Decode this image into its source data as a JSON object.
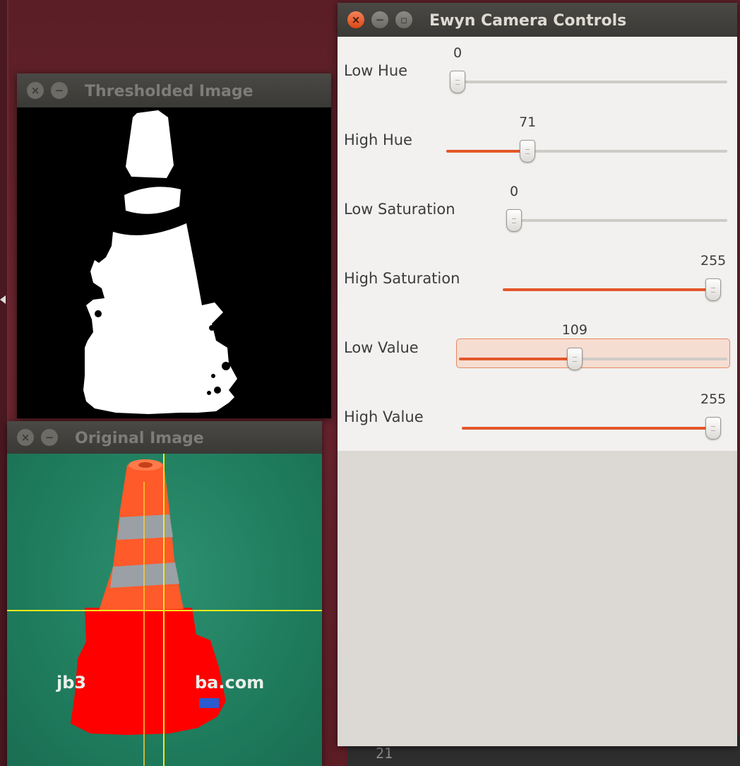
{
  "windows": {
    "thresholded": {
      "title": "Thresholded Image"
    },
    "original": {
      "title": "Original Image",
      "watermark_left": "jb3",
      "watermark_right": "ba.com"
    },
    "controls": {
      "title": "Ewyn Camera Controls"
    }
  },
  "controls": {
    "sliders": [
      {
        "label": "Low Hue",
        "value": "0",
        "level": 0
      },
      {
        "label": "High Hue",
        "value": "71",
        "level": 0.278
      },
      {
        "label": "Low Saturation",
        "value": "0",
        "level": 0
      },
      {
        "label": "High Saturation",
        "value": "255",
        "level": 1
      },
      {
        "label": "Low Value",
        "value": "109",
        "level": 0.427
      },
      {
        "label": "High Value",
        "value": "255",
        "level": 1
      }
    ],
    "focused_index": 4
  },
  "terminal": {
    "line_number": "21"
  },
  "colors": {
    "accent": "#e4572a",
    "mask_fg": "#ffffff",
    "mask_bg": "#000000",
    "detected_red": "#ff0000",
    "crosshair": "#f4e81a",
    "turf": "#1f7c5d"
  }
}
